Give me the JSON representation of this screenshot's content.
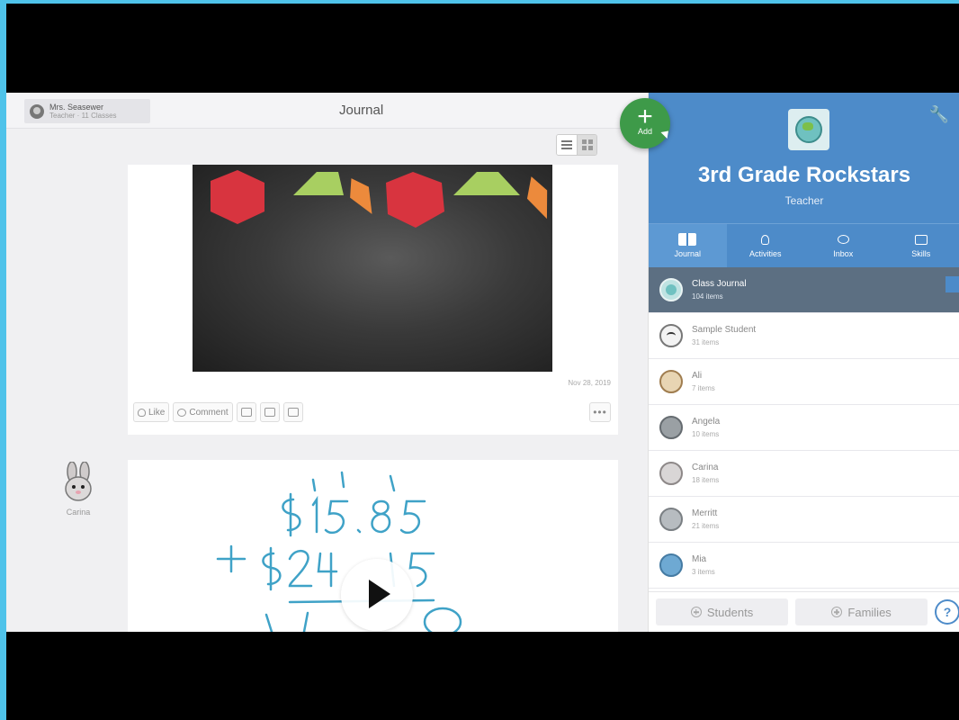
{
  "header": {
    "user_name": "Mrs. Seasewer",
    "user_sub": "Teacher · 11 Classes",
    "page_title": "Journal"
  },
  "add_button": {
    "label": "Add"
  },
  "post": {
    "date": "Nov 28, 2019",
    "actions": {
      "like": "Like",
      "comment": "Comment"
    },
    "more": "•••"
  },
  "post2": {
    "poster_name": "Carina"
  },
  "class": {
    "name": "3rd Grade Rockstars",
    "role": "Teacher"
  },
  "tabs": [
    {
      "label": "Journal",
      "icon": "book-icon"
    },
    {
      "label": "Activities",
      "icon": "bulb-icon"
    },
    {
      "label": "Inbox",
      "icon": "bubble-icon"
    },
    {
      "label": "Skills",
      "icon": "cap-icon"
    }
  ],
  "students": [
    {
      "name": "Class Journal",
      "count": "104 items",
      "avatar": "globe"
    },
    {
      "name": "Sample Student",
      "count": "31 items",
      "avatar": "ghost"
    },
    {
      "name": "Ali",
      "count": "7 items",
      "avatar": "dog"
    },
    {
      "name": "Angela",
      "count": "10 items",
      "avatar": "owl"
    },
    {
      "name": "Carina",
      "count": "18 items",
      "avatar": "bunny"
    },
    {
      "name": "Merritt",
      "count": "21 items",
      "avatar": "robot"
    },
    {
      "name": "Mia",
      "count": "3 items",
      "avatar": "whale"
    }
  ],
  "bottom": {
    "students_label": "Students",
    "families_label": "Families",
    "help": "?"
  },
  "colors": {
    "accent_blue": "#4d8bc9",
    "add_green": "#3e9a49",
    "page_border": "#4fc3ea"
  }
}
